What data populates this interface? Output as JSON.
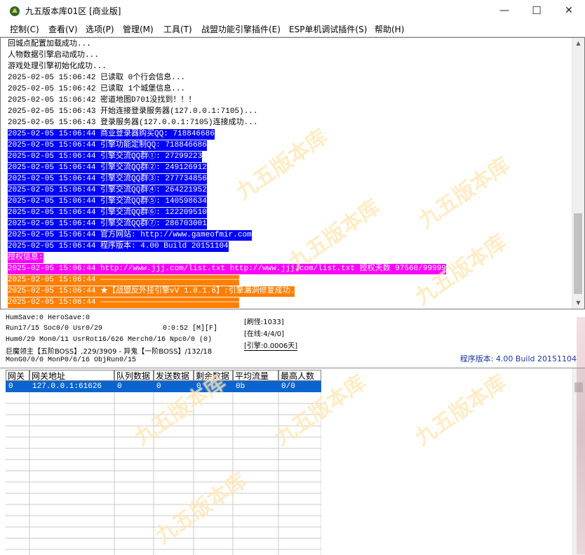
{
  "window": {
    "title": "九五版本库01区 [商业版]",
    "controls": {
      "minimize": "—",
      "maximize": "☐",
      "close": "✕"
    }
  },
  "menu": [
    "控制(C)",
    "查看(V)",
    "选项(P)",
    "管理(M)",
    "工具(T)",
    "战盟功能引擎插件(E)",
    "ESP单机调试插件(S)",
    "帮助(H)"
  ],
  "log": [
    {
      "text": "回城点配置加载成功...",
      "style": "plain"
    },
    {
      "text": "人物数据引擎启动成功...",
      "style": "plain"
    },
    {
      "text": "游戏处理引擎初始化成功...",
      "style": "plain"
    },
    {
      "text": "2025-02-05 15:06:42 已读取 0个行会信息...",
      "style": "plain"
    },
    {
      "text": "2025-02-05 15:06:42 已读取 1个城堡信息...",
      "style": "plain"
    },
    {
      "text": "2025-02-05 15:06:42 密道地图D701没找到！！！",
      "style": "plain"
    },
    {
      "text": "2025-02-05 15:06:43 开始连接登录服务器(127.0.0.1:7105)...",
      "style": "plain"
    },
    {
      "text": "2025-02-05 15:06:43 登录服务器(127.0.0.1:7105)连接成功...",
      "style": "plain"
    },
    {
      "text": "2025-02-05 15:06:44 商业登录器购买QQ: 718846686",
      "style": "blue"
    },
    {
      "text": "2025-02-05 15:06:44 引擎功能定制QQ: 718846686",
      "style": "blue"
    },
    {
      "text": "2025-02-05 15:06:44 引擎交流QQ群①: 27299223",
      "style": "blue"
    },
    {
      "text": "2025-02-05 15:06:44 引擎交流QQ群②: 249126912",
      "style": "blue"
    },
    {
      "text": "2025-02-05 15:06:44 引擎交流QQ群③: 277734856",
      "style": "blue"
    },
    {
      "text": "2025-02-05 15:06:44 引擎交流QQ群④: 264221952",
      "style": "blue"
    },
    {
      "text": "2025-02-05 15:06:44 引擎交流QQ群⑤: 140598634",
      "style": "blue"
    },
    {
      "text": "2025-02-05 15:06:44 引擎交流QQ群⑥: 122209510",
      "style": "blue"
    },
    {
      "text": "2025-02-05 15:06:44 引擎交流QQ群⑦: 286703001",
      "style": "blue"
    },
    {
      "text": "2025-02-05 15:06:44 官方网站: http://www.gameofmir.com",
      "style": "blue"
    },
    {
      "text": "2025-02-05 15:06:44 程序版本: 4.00 Build 20151104",
      "style": "blue"
    },
    {
      "text": "授权信息:",
      "style": "magenta"
    },
    {
      "text": "2025-02-05 15:06:44 http://www.jjj.com/list.txt http://www.jjj.com/list.txt 授权天数 97560/99999",
      "style": "magenta"
    },
    {
      "text": "2025-02-05 15:06:44 ——————————————————————————————",
      "style": "orange"
    },
    {
      "text": "2025-02-05 15:06:44 ★【战盟反外挂引擎vV 1.0.1.6】:引擎漏洞修复成功.",
      "style": "orange"
    },
    {
      "text": "2025-02-05 15:06:44 ——————————————————————————————",
      "style": "orange"
    }
  ],
  "status": {
    "line1": "HumSave:0 HeroSave:0",
    "line2": "Run17/15 Soc0/0 Usr0/29",
    "time": "0:0:52 [M][F]",
    "line3": "Hum0/29 Mon0/11 UsrRot16/626 Merch0/16 Npc0/0 (0)",
    "line4": "巨魔领主【五阶BOSS】,229/3909 - 异鬼【一阶BOSS】/132/18",
    "line5": "MonG0/0/0 MonP0/6/16 ObjRun0/15",
    "refresh": "[刷怪:1033]",
    "online": "[在线:4/4/0]",
    "engine": "[引擎:0.0006天]",
    "version": "程序版本: 4.00 Build 20151104"
  },
  "grid": {
    "headers": [
      "网关",
      "网关地址",
      "队列数据",
      "发送数据",
      "剩余数据",
      "平均流量",
      "最高人数"
    ],
    "rows": [
      [
        "0",
        "127.0.0.1:61626",
        "0",
        "0",
        "0",
        "0b",
        "0/0"
      ]
    ]
  },
  "watermark_text": "九五版本库",
  "colors": {
    "highlight_blue": "#0000ff",
    "highlight_magenta": "#ff00ff",
    "highlight_orange": "#ff7f00",
    "selection": "#0a64d0",
    "version_text": "#1a3aa0"
  }
}
